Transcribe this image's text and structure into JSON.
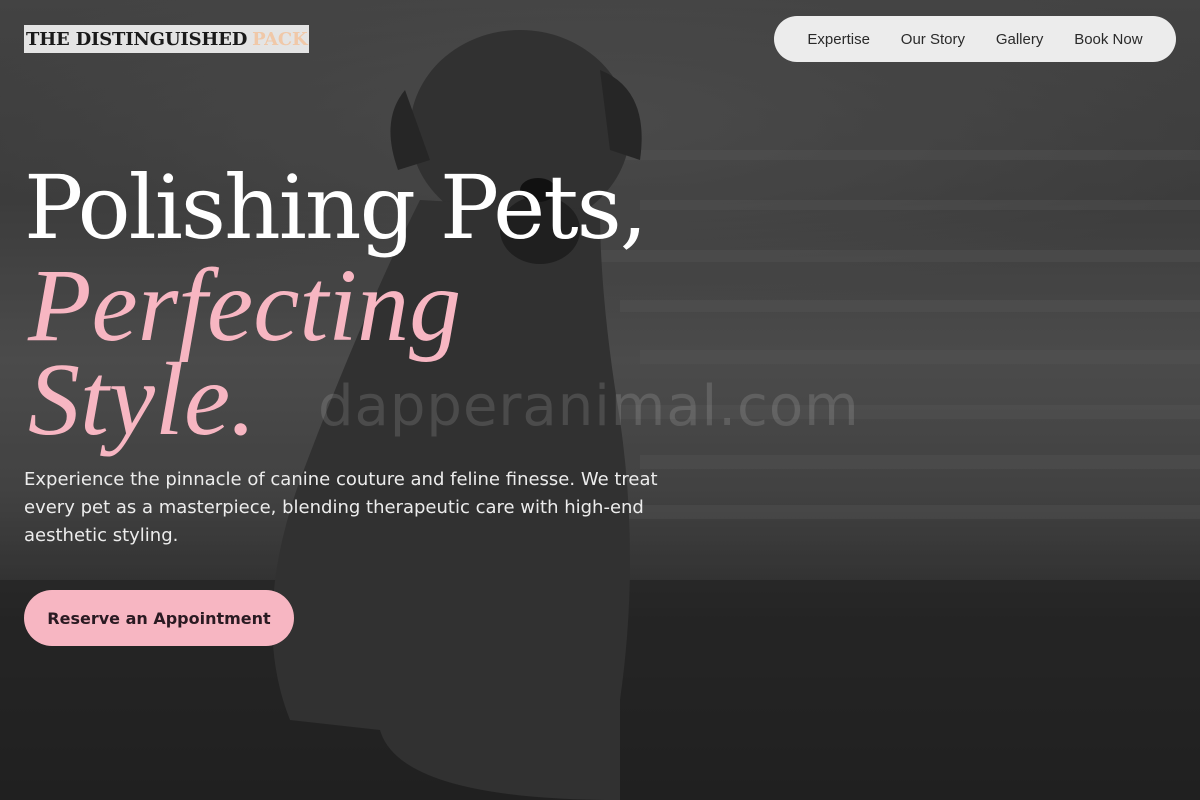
{
  "brand": {
    "name_main": "THE DISTINGUISHED",
    "name_accent": "PACK"
  },
  "nav": {
    "items": [
      {
        "label": "Expertise"
      },
      {
        "label": "Our Story"
      },
      {
        "label": "Gallery"
      },
      {
        "label": "Book Now"
      }
    ]
  },
  "hero": {
    "headline_line1": "Polishing Pets,",
    "headline_line2": "Perfecting",
    "headline_line3": "Style.",
    "watermark": "dapperanimal.com",
    "lead": "Experience the pinnacle of canine couture and feline finesse. We treat every pet as a masterpiece, blending therapeutic care with high-end aesthetic styling.",
    "cta_label": "Reserve an Appointment"
  },
  "colors": {
    "accent_pink": "#f7b6c2",
    "logo_accent": "#f0c8a8",
    "nav_bg": "#ececec"
  }
}
